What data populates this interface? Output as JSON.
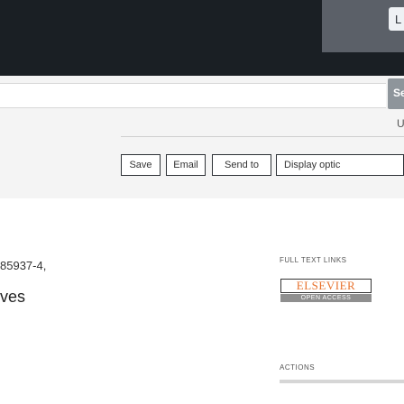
{
  "header": {
    "partial_label": "L",
    "colors": {
      "band": "#1a1f24",
      "tile": "#5b6068"
    }
  },
  "search": {
    "button_partial_label": "Sea",
    "partial_text": "U"
  },
  "toolbar": {
    "save_label": "Save",
    "email_label": "Email",
    "sendto_label": "Send to",
    "display_label": "Display optic"
  },
  "article": {
    "partial_number": "85937-4,",
    "partial_word": "ves"
  },
  "sidebar": {
    "full_text_links_heading": "FULL TEXT LINKS",
    "publisher_logo": "ELSEVIER",
    "access_label": "OPEN ACCESS",
    "actions_heading": "ACTIONS",
    "colors": {
      "publisher": "#e8722d"
    }
  }
}
